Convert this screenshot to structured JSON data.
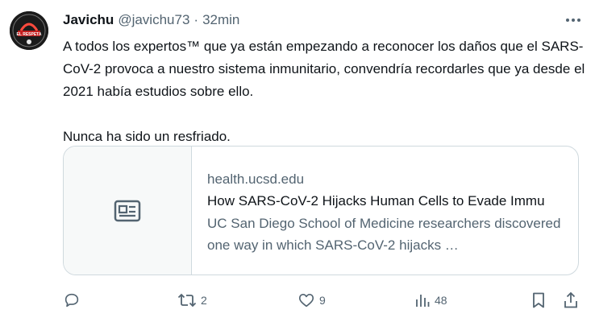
{
  "tweet": {
    "author_name": "Javichu",
    "handle": "@javichu73",
    "separator": "·",
    "time": "32min",
    "avatar_text": "EL RESPETA",
    "paragraphs": [
      "A todos los expertos™ que ya están empezando a reconocer los daños que el SARS-CoV-2 provoca a nuestro sistema inmunitario, convendría recordarles que ya desde el 2021 había estudios sobre ello.",
      "Nunca ha sido un resfriado."
    ]
  },
  "card": {
    "domain": "health.ucsd.edu",
    "title": "How SARS-CoV-2 Hijacks Human Cells to Evade Immu",
    "description": "UC San Diego School of Medicine researchers discovered one way in which SARS-CoV-2 hijacks …",
    "icon": "article-icon"
  },
  "actions": {
    "reply_count": "",
    "retweet_count": "2",
    "like_count": "9",
    "views_count": "48"
  },
  "colors": {
    "text": "#0f1419",
    "secondary": "#536471",
    "border": "#cfd9de",
    "card_thumb_bg": "#f7f9f9"
  }
}
